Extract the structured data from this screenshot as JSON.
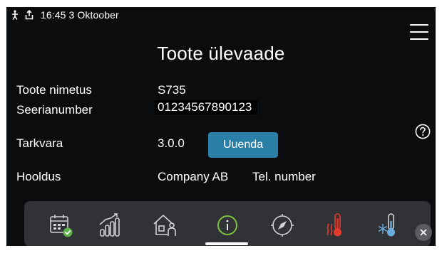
{
  "status_bar": {
    "person_icon": "person-walking-icon",
    "upload_icon": "upload-tray-icon",
    "datetime": "16:45 3  Oktoober"
  },
  "header": {
    "menu_icon": "hamburger-menu-icon"
  },
  "page": {
    "title": "Toote ülevaade"
  },
  "info": {
    "product_name_label": "Toote nimetus",
    "product_name_value": "S735",
    "serial_label": "Seerianumber",
    "serial_value": "01234567890123",
    "software_label": "Tarkvara",
    "software_value": "3.0.0",
    "update_button": "Uuenda",
    "service_label": "Hooldus",
    "service_company": "Company AB",
    "service_phone": "Tel. number"
  },
  "help_icon": "question-circle-icon",
  "nav": {
    "items": [
      {
        "name": "calendar-check-icon"
      },
      {
        "name": "bar-graph-icon"
      },
      {
        "name": "house-person-icon"
      },
      {
        "name": "info-icon",
        "active": true
      },
      {
        "name": "compass-icon"
      },
      {
        "name": "heat-thermometer-icon"
      },
      {
        "name": "cold-thermometer-icon"
      }
    ],
    "close_icon": "close-icon"
  },
  "colors": {
    "background": "#0b0c0e",
    "bottom_bar": "#303236",
    "update_button": "#2a7fa6",
    "info_green": "#7fbf3f",
    "heat_red": "#e53b2f",
    "cold_blue": "#6aaee0",
    "calendar_check_green": "#5fb34a"
  }
}
